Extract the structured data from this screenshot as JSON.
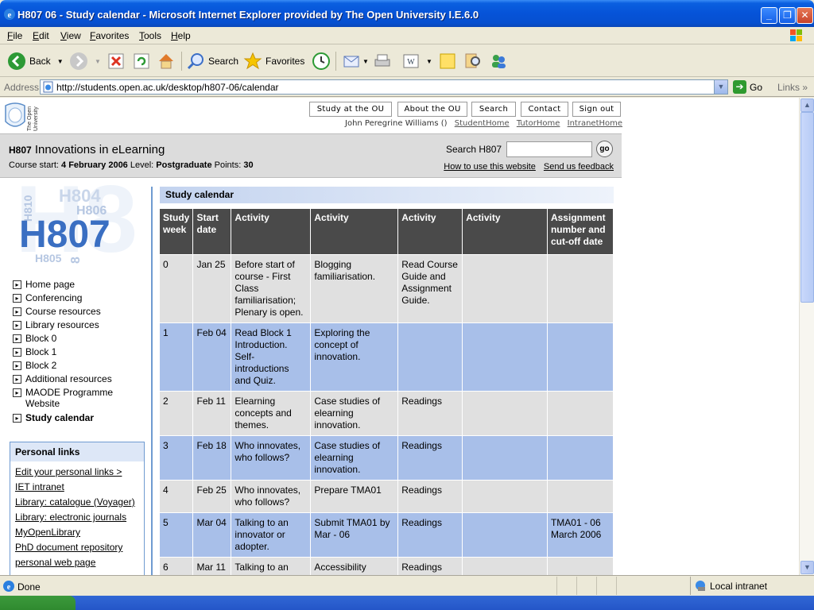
{
  "window": {
    "title": "H807 06 - Study calendar - Microsoft Internet Explorer provided by The Open University I.E.6.0"
  },
  "menu": [
    {
      "key": "F",
      "rest": "ile"
    },
    {
      "key": "E",
      "rest": "dit"
    },
    {
      "key": "V",
      "rest": "iew"
    },
    {
      "key": "F",
      "rest": "avorites",
      "pre": ""
    },
    {
      "key": "T",
      "rest": "ools"
    },
    {
      "key": "H",
      "rest": "elp"
    }
  ],
  "toolbar": {
    "back": "Back",
    "search": "Search",
    "favorites": "Favorites"
  },
  "address": {
    "label": "Address",
    "url": "http://students.open.ac.uk/desktop/h807-06/calendar",
    "go": "Go",
    "links": "Links"
  },
  "site": {
    "logo_text": "The Open University",
    "top_buttons": [
      "Study at the OU",
      "About the OU",
      "Search",
      "Contact",
      "Sign out"
    ],
    "user_name": "John Peregrine Williams ()",
    "user_links": [
      "StudentHome",
      "TutorHome",
      "IntranetHome"
    ]
  },
  "course": {
    "code": "H807",
    "name": "Innovations in eLearning",
    "start_label": "Course start:",
    "start_value": "4 February 2006",
    "level_label": "Level:",
    "level_value": "Postgraduate",
    "points_label": "Points:",
    "points_value": "30",
    "search_label": "Search H807",
    "search_value": "",
    "go_label": "go",
    "help_link": "How to use this website",
    "feedback_link": "Send us feedback"
  },
  "nav": {
    "logo_main": "H807",
    "logo_fragments": [
      "H804",
      "H806",
      "H805",
      "H808",
      "H810"
    ],
    "items": [
      {
        "label": "Home page",
        "active": false
      },
      {
        "label": "Conferencing",
        "active": false
      },
      {
        "label": "Course resources",
        "active": false
      },
      {
        "label": "Library resources",
        "active": false
      },
      {
        "label": "Block 0",
        "active": false
      },
      {
        "label": "Block 1",
        "active": false
      },
      {
        "label": "Block 2",
        "active": false
      },
      {
        "label": "Additional resources",
        "active": false
      },
      {
        "label": "MAODE Programme Website",
        "active": false
      },
      {
        "label": "Study calendar",
        "active": true
      }
    ]
  },
  "personal_links": {
    "heading": "Personal links",
    "links": [
      "Edit your personal links >",
      "IET intranet",
      "Library: catalogue (Voyager)",
      "Library: electronic journals",
      "MyOpenLibrary",
      "PhD document repository",
      "personal web page"
    ]
  },
  "calendar": {
    "heading": "Study calendar",
    "columns": [
      "Study week",
      "Start date",
      "Activity",
      "Activity",
      "Activity",
      "Activity",
      "Assignment number and cut-off date"
    ],
    "rows": [
      [
        "0",
        "Jan 25",
        "Before start of course - First Class familiarisation; Plenary is open.",
        "Blogging familiarisation.",
        "Read Course Guide and Assignment Guide.",
        "",
        ""
      ],
      [
        "1",
        "Feb 04",
        "Read Block 1 Introduction. Self-introductions and Quiz.",
        "Exploring the concept of innovation.",
        "",
        "",
        ""
      ],
      [
        "2",
        "Feb 11",
        "Elearning concepts and themes.",
        "Case studies of elearning innovation.",
        "Readings",
        "",
        ""
      ],
      [
        "3",
        "Feb 18",
        "Who innovates, who follows?",
        "Case studies of elearning innovation.",
        "Readings",
        "",
        ""
      ],
      [
        "4",
        "Feb 25",
        "Who innovates, who follows?",
        "Prepare TMA01",
        "Readings",
        "",
        ""
      ],
      [
        "5",
        "Mar 04",
        "Talking to an innovator or adopter.",
        "Submit TMA01 by Mar - 06",
        "Readings",
        "",
        "TMA01 - 06 March 2006"
      ],
      [
        "6",
        "Mar 11",
        "Talking to an innovator or",
        "Accessibility",
        "Readings",
        "",
        ""
      ]
    ]
  },
  "status": {
    "text": "Done",
    "zone": "Local intranet"
  }
}
